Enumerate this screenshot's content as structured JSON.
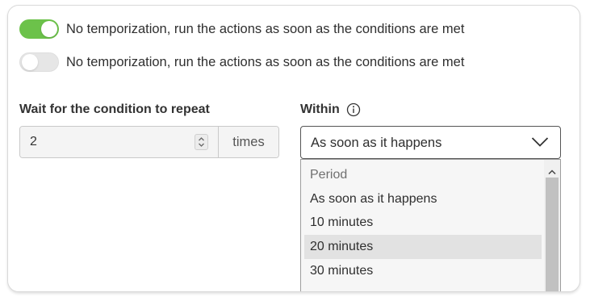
{
  "toggles": [
    {
      "label": "No temporization, run the actions as soon as the conditions are met",
      "state": "on"
    },
    {
      "label": "No temporization, run the actions as soon as the conditions are met",
      "state": "off"
    }
  ],
  "repeat": {
    "label": "Wait for the condition to repeat",
    "value": "2",
    "suffix": "times"
  },
  "within": {
    "label": "Within",
    "selected": "As soon as it happens",
    "options_header": "Period",
    "options": [
      "As soon as it happens",
      "10 minutes",
      "20 minutes",
      "30 minutes"
    ],
    "highlighted_option": "20 minutes"
  },
  "colors": {
    "toggle_on": "#6cc24a",
    "toggle_off": "#e6e6e6",
    "highlight": "#e2e2e2"
  },
  "icons": {
    "info": "info-circle-icon",
    "chevron": "chevron-down-icon",
    "stepper": "up-down-stepper-icon",
    "scroll_up": "scroll-up-arrow-icon"
  }
}
